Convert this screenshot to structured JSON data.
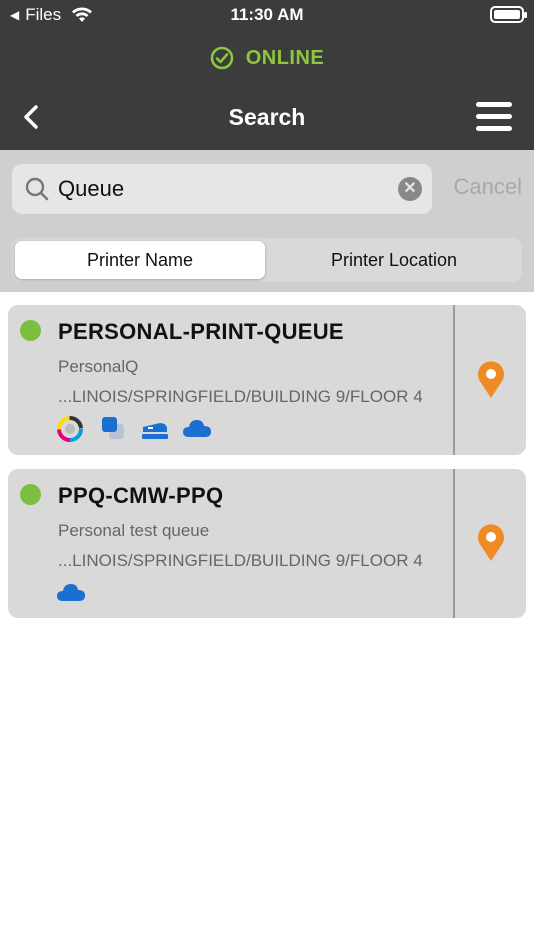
{
  "status_bar": {
    "back_app": "Files",
    "time": "11:30 AM"
  },
  "connection": {
    "label": "ONLINE"
  },
  "nav": {
    "title": "Search"
  },
  "search": {
    "value": "Queue",
    "cancel_label": "Cancel"
  },
  "segments": {
    "active": "Printer Name",
    "inactive": "Printer Location"
  },
  "printers": [
    {
      "name": "PERSONAL-PRINT-QUEUE",
      "description": "PersonalQ",
      "location": "...LINOIS/SPRINGFIELD/BUILDING 9/FLOOR 4",
      "features": [
        "color-wheel-icon",
        "duplex-copies-icon",
        "stapler-icon",
        "cloud-icon"
      ]
    },
    {
      "name": "PPQ-CMW-PPQ",
      "description": "Personal test queue",
      "location": "...LINOIS/SPRINGFIELD/BUILDING 9/FLOOR 4",
      "features": [
        "cloud-icon"
      ]
    }
  ],
  "colors": {
    "bar": "#3c3c3c",
    "online": "#8dc63f",
    "status_online": "#7cbf3e",
    "pin": "#f08a24",
    "feature_blue": "#1a6fd1"
  }
}
